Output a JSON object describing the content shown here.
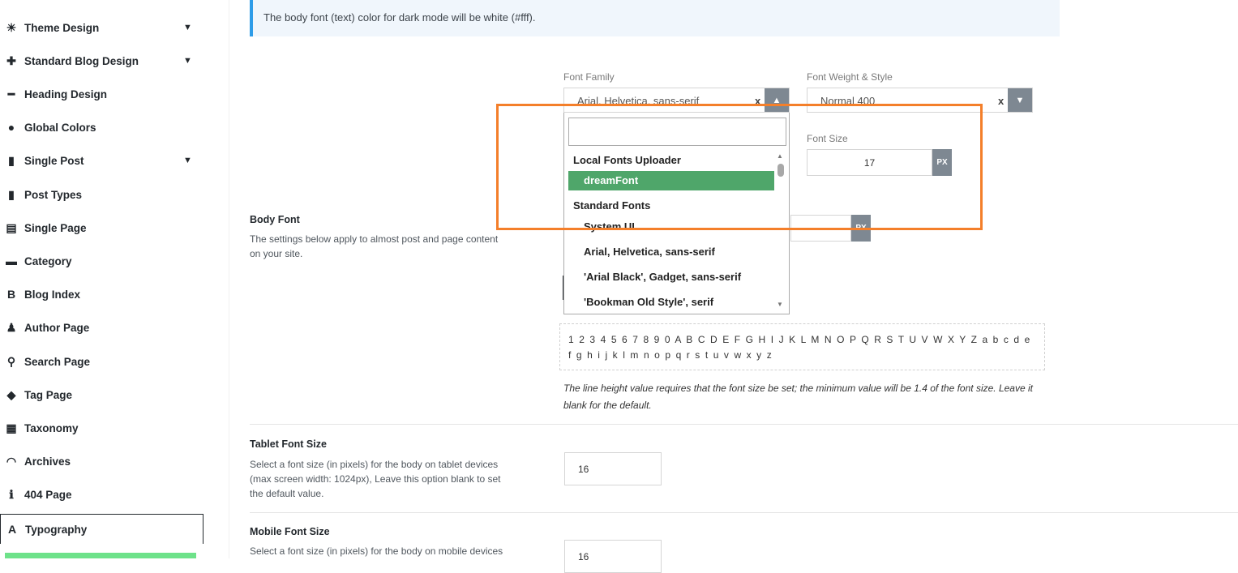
{
  "sidebar": {
    "items": [
      {
        "label": "Theme Design",
        "icon": "lightbulb-icon",
        "glyph": "☀",
        "arrow": "▼"
      },
      {
        "label": "Standard Blog Design",
        "icon": "puzzle-icon",
        "glyph": "✚",
        "arrow": "▼"
      },
      {
        "label": "Heading Design",
        "icon": "minus-icon",
        "glyph": "━",
        "arrow": ""
      },
      {
        "label": "Global Colors",
        "icon": "droplet-icon",
        "glyph": "●",
        "arrow": ""
      },
      {
        "label": "Single Post",
        "icon": "file-icon",
        "glyph": "▮",
        "arrow": "▼"
      },
      {
        "label": "Post Types",
        "icon": "file-icon",
        "glyph": "▮",
        "arrow": ""
      },
      {
        "label": "Single Page",
        "icon": "document-icon",
        "glyph": "▤",
        "arrow": ""
      },
      {
        "label": "Category",
        "icon": "folder-icon",
        "glyph": "▬",
        "arrow": ""
      },
      {
        "label": "Blog Index",
        "icon": "bold-b-icon",
        "glyph": "B",
        "arrow": ""
      },
      {
        "label": "Author Page",
        "icon": "user-icon",
        "glyph": "♟",
        "arrow": ""
      },
      {
        "label": "Search Page",
        "icon": "search-icon",
        "glyph": "⚲",
        "arrow": ""
      },
      {
        "label": "Tag Page",
        "icon": "tags-icon",
        "glyph": "◆",
        "arrow": ""
      },
      {
        "label": "Taxonomy",
        "icon": "briefcase-icon",
        "glyph": "▦",
        "arrow": ""
      },
      {
        "label": "Archives",
        "icon": "inbox-icon",
        "glyph": "◠",
        "arrow": ""
      },
      {
        "label": "404 Page",
        "icon": "info-icon",
        "glyph": "ℹ",
        "arrow": ""
      },
      {
        "label": "Typography",
        "icon": "font-icon",
        "glyph": "A",
        "arrow": ""
      }
    ]
  },
  "notice": {
    "text": "The body font (text) color for dark mode will be white (#fff)."
  },
  "font_family": {
    "label": "Font Family",
    "value": "Arial, Helvetica, sans-serif",
    "clear": "x",
    "toggle": "▲"
  },
  "font_weight": {
    "label": "Font Weight & Style",
    "value": "Normal 400",
    "clear": "x",
    "toggle": "▼"
  },
  "font_size": {
    "label": "Font Size",
    "value": "17",
    "unit": "PX"
  },
  "line_height": {
    "unit": "PX"
  },
  "body_font": {
    "title": "Body Font",
    "desc": "The settings below apply to almost post and page content on your site."
  },
  "dropdown": {
    "search_value": "",
    "group1": "Local Fonts Uploader",
    "highlighted": "dreamFont",
    "group2": "Standard Fonts",
    "options": [
      "System UI",
      "Arial, Helvetica, sans-serif",
      "'Arial Black', Gadget, sans-serif",
      "'Bookman Old Style', serif"
    ]
  },
  "preview_text": "1 2 3 4 5 6 7 8 9 0 A B C D E F G H I J K L M N O P Q R S T U V W X Y Z a b c d e f g h i j k l m n o p q r s t u v w x y z",
  "line_height_note": "The line height value requires that the font size be set; the minimum value will be 1.4 of the font size. Leave it blank for the default.",
  "tablet": {
    "title": "Tablet Font Size",
    "desc": "Select a font size (in pixels) for the body on tablet devices (max screen width: 1024px), Leave this option blank to set the default value.",
    "value": "16"
  },
  "mobile": {
    "title": "Mobile Font Size",
    "desc": "Select a font size (in pixels) for the body on mobile devices",
    "value": "16"
  },
  "colors": {
    "highlight": "#f47f2a",
    "accent_green": "#4fa66a",
    "notice_border": "#2d9ce8"
  }
}
